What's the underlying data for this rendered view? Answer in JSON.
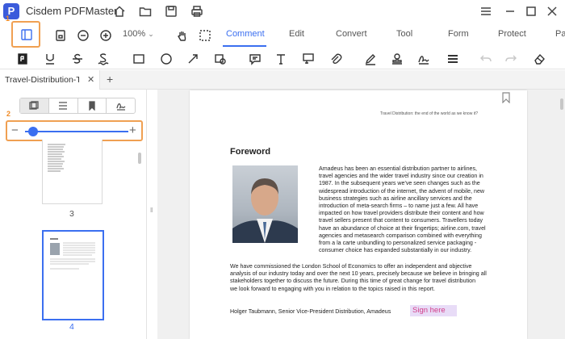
{
  "app": {
    "title": "Cisdem PDFMaster"
  },
  "toolbar": {
    "zoom": "100%",
    "nav_tabs": [
      "Comment",
      "Edit",
      "Convert",
      "Tool",
      "Form",
      "Protect",
      "Pa"
    ],
    "active_tab": "Comment"
  },
  "document_tab": {
    "label": "Travel-Distribution-T..."
  },
  "sidebar": {
    "thumbnails": [
      {
        "page": "3"
      },
      {
        "page": "4"
      }
    ],
    "zoom_slider": {
      "minus": "−",
      "plus": "+",
      "level": 0.08
    }
  },
  "callouts": {
    "one": "1",
    "two": "2"
  },
  "page": {
    "running_head": "Travel Distribution: the end of the world as we know it?",
    "heading": "Foreword",
    "para1_lines": [
      "Amadeus has been an essential distribution partner to airlines,",
      "travel agencies and the wider travel industry since our creation in",
      "1987. In the subsequent years we've seen changes such as the",
      "widespread introduction of the internet, the advent of mobile, new",
      "business strategies such as airline ancillary services and the",
      "introduction of meta-search firms – to name just a few. All have",
      "impacted on how travel providers distribute their content and how",
      "travel sellers present that content to consumers. Travellers today",
      "have an abundance of choice at their fingertips; airline.com, travel",
      "agencies and metasearch comparison combined with everything",
      "from a la carte unbundling to personalized service packaging -",
      "consumer choice has expanded substantially in our industry."
    ],
    "para2_lines": [
      "We have commissioned the London School of Economics to offer an independent and objective",
      "analysis of our industry today and over the next 10 years, precisely because we believe in bringing all",
      "stakeholders together to discuss the future.  During this time of great change for travel distribution",
      "we look forward to engaging with you in relation to the topics raised in this report."
    ],
    "signature_line": "Holger Taubmann, Senior Vice-President Distribution, Amadeus",
    "sign_here": "Sign here"
  }
}
